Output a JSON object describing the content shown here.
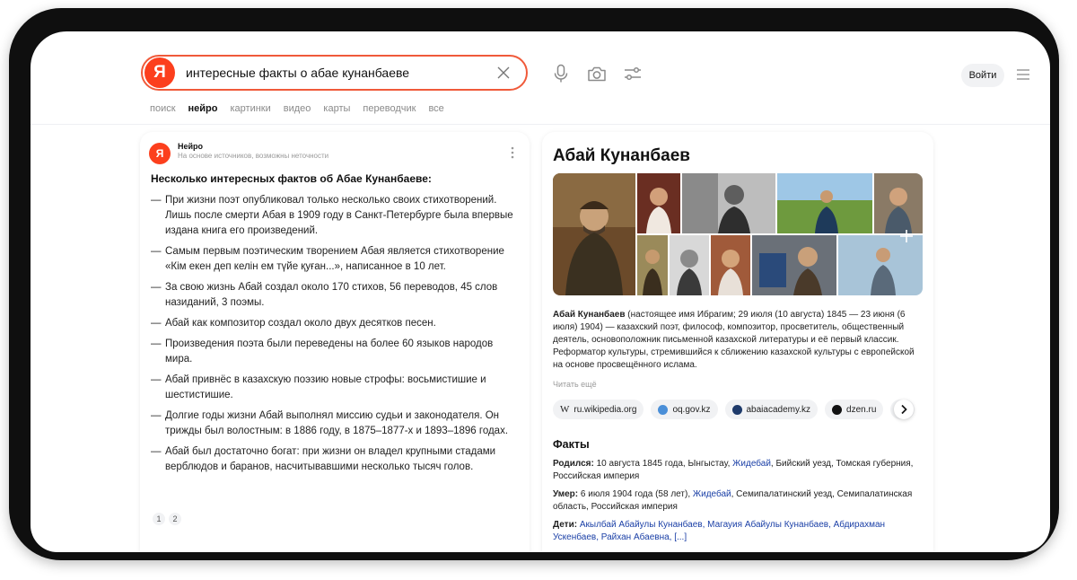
{
  "search": {
    "logo_letter": "Я",
    "query": "интересные факты о абае кунанбаеве"
  },
  "header": {
    "login_label": "Войти"
  },
  "tabs": [
    {
      "label": "поиск"
    },
    {
      "label": "нейро"
    },
    {
      "label": "картинки"
    },
    {
      "label": "видео"
    },
    {
      "label": "карты"
    },
    {
      "label": "переводчик"
    },
    {
      "label": "все"
    }
  ],
  "neuro": {
    "name": "Нейро",
    "subtitle": "На основе источников, возможны неточности",
    "answer_title": "Несколько интересных фактов об Абае Кунанбаеве:",
    "facts": [
      "При жизни поэт опубликовал только несколько своих стихотворений. Лишь после смерти Абая в 1909 году в Санкт-Петербурге была впервые издана книга его произведений.",
      "Самым первым поэтическим творением Абая является стихотворение «Кім екен деп келін ем түйе қуған...», написанное в 10 лет.",
      "За свою жизнь Абай создал около 170 стихов, 56 переводов, 45 слов назиданий, 3 поэмы.",
      "Абай как композитор создал около двух десятков песен.",
      "Произведения поэта были переведены на более 60 языков народов мира.",
      "Абай привнёс в казахскую поэзию новые строфы: восьмистишие и шестистишие.",
      "Долгие годы жизни Абай выполнял миссию судьи и законодателя. Он трижды был волостным: в 1886 году, в 1875–1877-х и 1893–1896 годах.",
      "Абай был достаточно богат: при жизни он владел крупными стадами верблюдов и баранов, насчитывавшими несколько тысяч голов."
    ],
    "pages": [
      "1",
      "2"
    ]
  },
  "entity": {
    "title": "Абай Кунанбаев",
    "bio_name": "Абай Кунанбаев",
    "bio_rest": " (настоящее имя Ибрагим; 29 июля (10 августа) 1845 — 23 июня (6 июля) 1904) — казахский поэт, философ, композитор, просветитель, общественный деятель, основоположник письменной казахской литературы и её первый классик. Реформатор культуры, стремившийся к сближению казахской культуры с европейской на основе просвещённого ислама.",
    "read_more": "Читать ещё",
    "sources": [
      {
        "label": "ru.wikipedia.org",
        "icon": "wikipedia-icon"
      },
      {
        "label": "oq.gov.kz",
        "icon": "oq-icon"
      },
      {
        "label": "abaiacademy.kz",
        "icon": "abaiacademy-icon"
      },
      {
        "label": "dzen.ru",
        "icon": "dzen-icon"
      }
    ],
    "facts_heading": "Факты",
    "born": {
      "key": "Родился:",
      "pre": " 10 августа 1845 года, Ынгыстау, ",
      "link": "Жидебай",
      "post": ", Бийский уезд, Томская губерния, Российская империя"
    },
    "died": {
      "key": "Умер:",
      "pre": " 6 июля 1904 года (58 лет), ",
      "link": "Жидебай",
      "post": ", Семипалатинский уезд, Семипалатинская область, Российская империя"
    },
    "children": {
      "key": "Дети:",
      "links": "Акылбай Абайулы Кунанбаев, Магауия Абайулы Кунанбаев, Абдирахман Ускенбаев, Райхан Абаевна, [...]"
    }
  },
  "colors": {
    "brand": "#fc3f1d",
    "search_border": "#f05a3a",
    "link": "#1a3fa6"
  }
}
